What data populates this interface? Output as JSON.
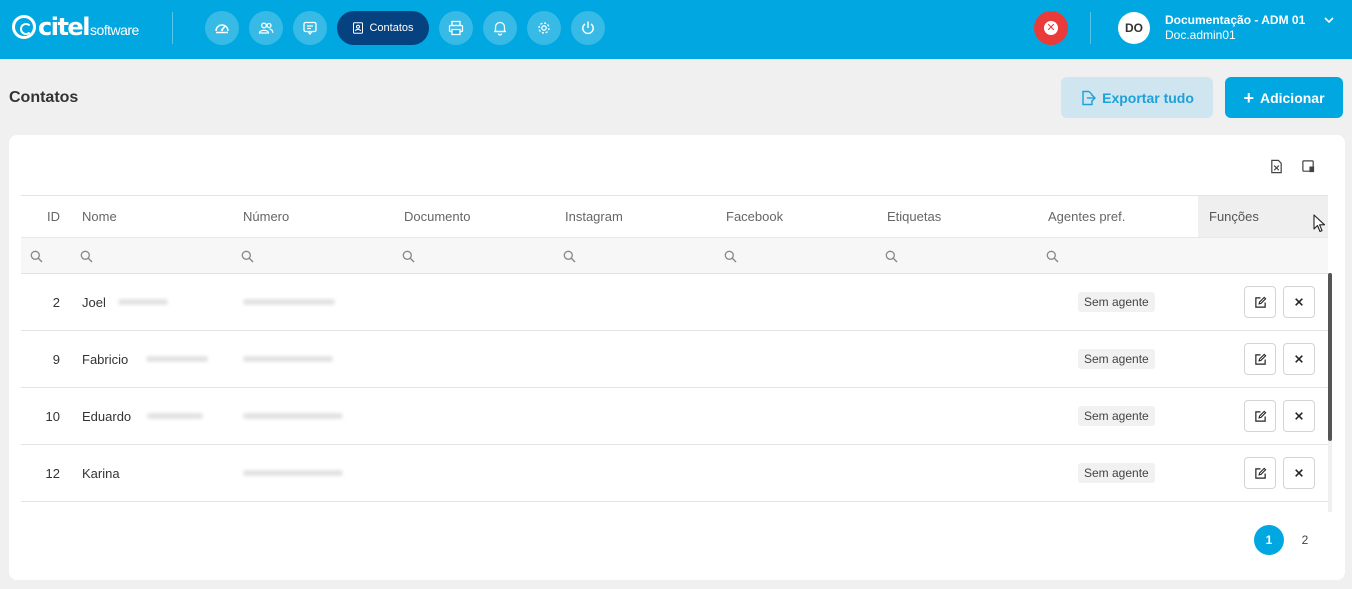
{
  "brand": {
    "logo_word": "citel",
    "logo_sub": "software"
  },
  "nav": {
    "items": [
      {
        "icon": "dashboard-icon"
      },
      {
        "icon": "users-icon"
      },
      {
        "icon": "chat-icon"
      },
      {
        "icon": "contacts-icon",
        "label": "Contatos",
        "active": true
      },
      {
        "icon": "printer-icon"
      },
      {
        "icon": "bell-icon"
      },
      {
        "icon": "gear-icon"
      },
      {
        "icon": "power-icon"
      }
    ]
  },
  "user": {
    "initials": "DO",
    "name": "Documentação - ADM 01",
    "login": "Doc.admin01"
  },
  "alert": {
    "icon": "close-circle-icon",
    "glyph": "✕"
  },
  "page": {
    "title": "Contatos"
  },
  "actions": {
    "export_label": "Exportar tudo",
    "add_label": "Adicionar",
    "add_glyph": "+"
  },
  "table": {
    "columns": [
      "ID",
      "Nome",
      "Número",
      "Documento",
      "Instagram",
      "Facebook",
      "Etiquetas",
      "Agentes pref.",
      "Funções"
    ],
    "rows": [
      {
        "id": "2",
        "name": "Joel",
        "agent": "Sem agente"
      },
      {
        "id": "9",
        "name": "Fabricio",
        "agent": "Sem agente"
      },
      {
        "id": "10",
        "name": "Eduardo",
        "agent": "Sem agente"
      },
      {
        "id": "12",
        "name": "Karina",
        "agent": "Sem agente"
      }
    ]
  },
  "pagination": {
    "current": "1",
    "next": "2"
  },
  "colors": {
    "primary": "#01a7e1",
    "nav_active": "#064180",
    "danger": "#ea3b3b",
    "export_bg": "#cfe6f1"
  }
}
